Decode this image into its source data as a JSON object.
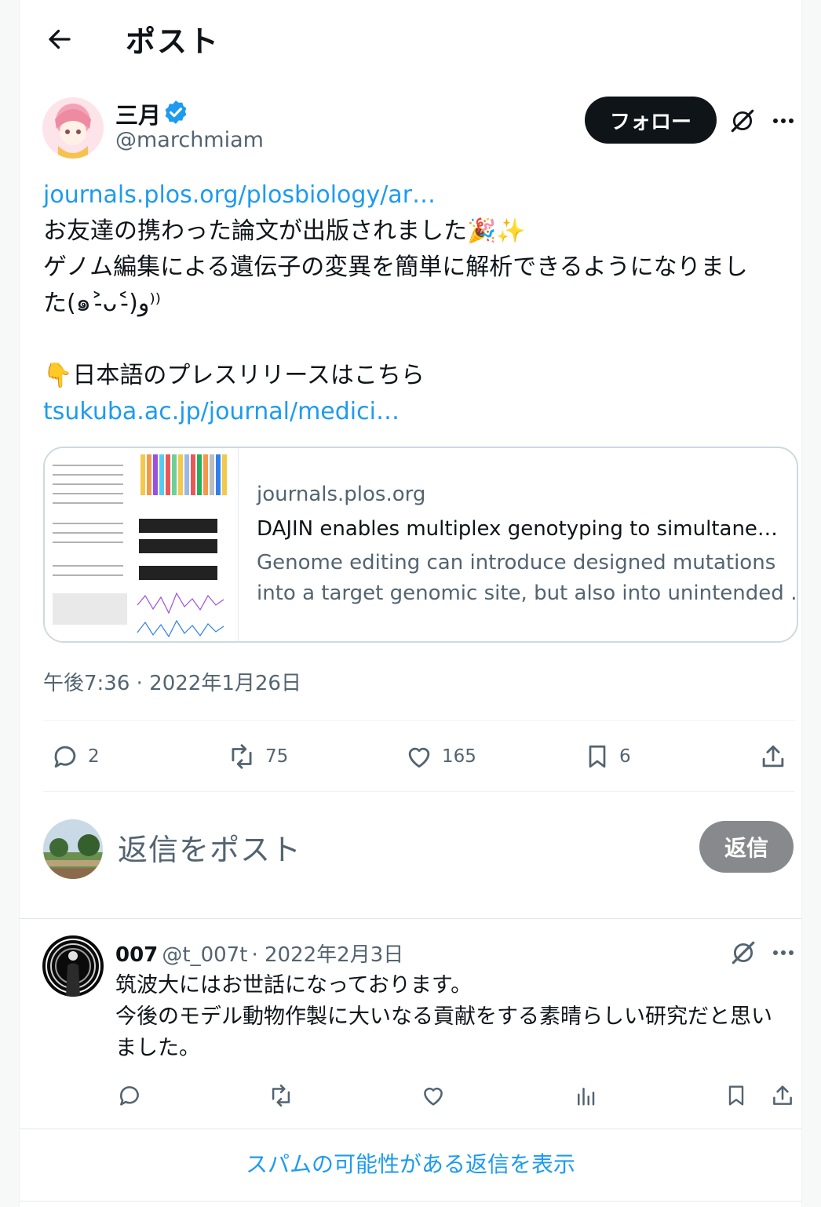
{
  "header": {
    "title": "ポスト",
    "back_icon": "arrow-left-icon"
  },
  "post": {
    "author": {
      "name": "三月",
      "handle": "@marchmiam",
      "verified": true
    },
    "follow_label": "フォロー",
    "link1": "journals.plos.org/plosbiology/ar…",
    "line1": "お友達の携わった論文が出版されました🎉✨",
    "line2": "ゲノム編集による遺伝子の変異を簡単に解析できるようになりまし",
    "line3": "た(๑˃̵ᴗ˂̵)و⁾⁾",
    "line4": "👇日本語のプレスリリースはこちら",
    "link2": "tsukuba.ac.jp/journal/medici…",
    "card": {
      "domain": "journals.plos.org",
      "title": "DAJIN enables multiplex genotyping to simultaneou…",
      "desc_line1": "Genome editing can introduce designed mutations",
      "desc_line2": "into a target genomic site, but also into unintended …"
    },
    "timestamp": "午後7:36 · 2022年1月26日",
    "stats": {
      "replies": "2",
      "reposts": "75",
      "likes": "165",
      "bookmarks": "6"
    }
  },
  "composer": {
    "placeholder": "返信をポスト",
    "button": "返信"
  },
  "reply": {
    "name": "007",
    "handle": "@t_007t",
    "date": "· 2022年2月3日",
    "line1": "筑波大にはお世話になっております。",
    "line2": "今後のモデル動物作製に大いなる貢献をする素晴らしい研究だと思い",
    "line3": "ました。"
  },
  "spam_link": "スパムの可能性がある返信を表示",
  "colors": {
    "accent": "#1d9bf0",
    "text": "#0f1419",
    "muted": "#536471",
    "border": "#cfd9de"
  }
}
